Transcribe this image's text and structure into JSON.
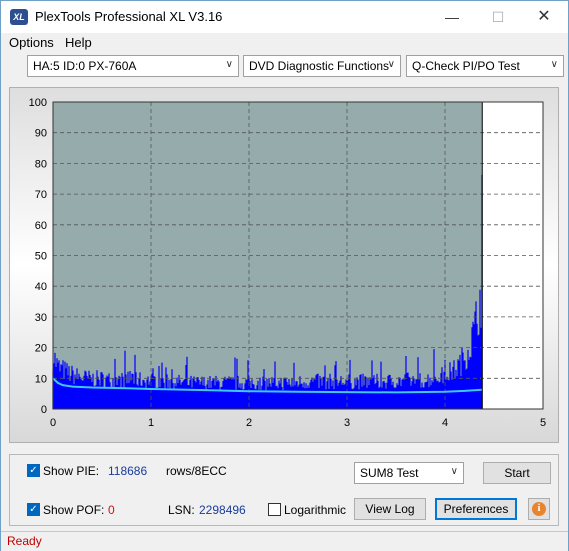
{
  "window": {
    "title": "PlexTools Professional XL V3.16",
    "icon_text": "XL"
  },
  "menu": {
    "options": "Options",
    "help": "Help"
  },
  "toolbar": {
    "drive": "HA:5 ID:0  PX-760A",
    "function": "DVD Diagnostic Functions",
    "test": "Q-Check PI/PO Test"
  },
  "chart_data": {
    "type": "area",
    "title": "",
    "xlabel": "",
    "ylabel": "",
    "xlim": [
      0,
      5
    ],
    "ylim": [
      0,
      100
    ],
    "x_ticks": [
      "0",
      "1",
      "2",
      "3",
      "4",
      "5"
    ],
    "y_ticks": [
      "0",
      "10",
      "20",
      "30",
      "40",
      "50",
      "60",
      "70",
      "80",
      "90",
      "100"
    ],
    "grid": true,
    "end_marker_x": 4.38,
    "colors": {
      "pie": "#0000ff",
      "avg": "#40c8f0",
      "background": "#96acac",
      "after_end": "#ffffff"
    },
    "series": [
      {
        "kind": "max_envelope",
        "x": [
          0,
          0.05,
          0.1,
          0.2,
          0.3,
          0.4,
          0.5,
          0.6,
          0.7,
          0.8,
          0.9,
          1.0,
          1.2,
          1.4,
          1.6,
          1.8,
          2.0,
          2.2,
          2.4,
          2.6,
          2.8,
          3.0,
          3.2,
          3.4,
          3.6,
          3.8,
          3.9,
          4.0,
          4.05,
          4.1,
          4.15,
          4.2,
          4.25,
          4.3,
          4.33,
          4.36,
          4.38
        ],
        "y": [
          21,
          16,
          15,
          13,
          12,
          11.5,
          11.5,
          11,
          11,
          12,
          11,
          11,
          10.5,
          10,
          10,
          10,
          10,
          10,
          10,
          10.5,
          10.5,
          10.5,
          10.5,
          10.5,
          11,
          11,
          12,
          13,
          14,
          15,
          17,
          20,
          24,
          30,
          36,
          42,
          47
        ]
      },
      {
        "kind": "average",
        "x": [
          0,
          0.05,
          0.1,
          0.2,
          0.4,
          0.7,
          1.0,
          1.5,
          2.0,
          2.5,
          3.0,
          3.5,
          4.0,
          4.2,
          4.38
        ],
        "y": [
          10,
          8.5,
          7.8,
          7.3,
          7,
          6.8,
          6.5,
          6.2,
          5.8,
          5.6,
          5.5,
          5.4,
          5.6,
          5.9,
          6.3
        ]
      }
    ]
  },
  "bottom": {
    "show_pie_label": "Show PIE:",
    "pie_value": "118686",
    "pie_unit": "rows/8ECC",
    "show_pof_label": "Show POF:",
    "pof_value": "0",
    "lsn_label": "LSN:",
    "lsn_value": "2298496",
    "logarithmic_label": "Logarithmic",
    "sum_select": "SUM8 Test",
    "start_button": "Start",
    "view_log_button": "View Log",
    "preferences_button": "Preferences"
  },
  "status": {
    "text": "Ready"
  }
}
